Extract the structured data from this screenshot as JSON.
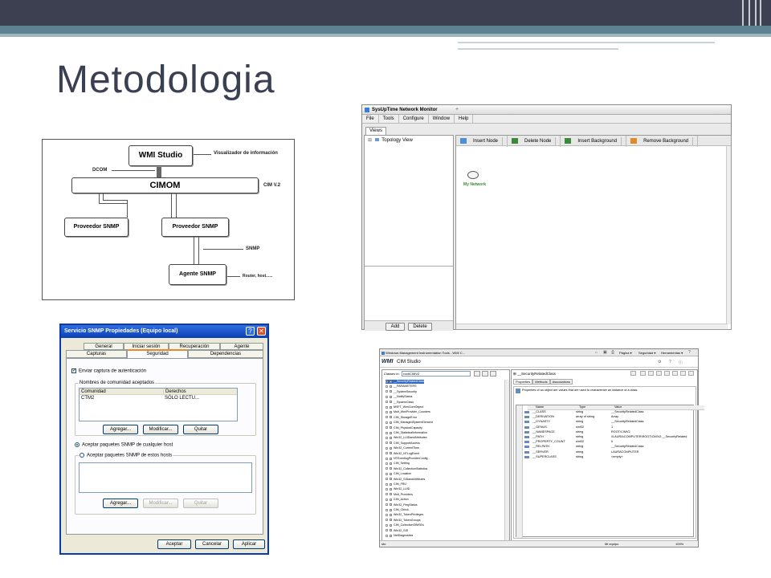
{
  "slide": {
    "title": "Metodologia"
  },
  "diagram": {
    "wmi_studio": "WMI Studio",
    "visualizador": "Visualizador de información",
    "dcom": "DCOM",
    "cimom": "CIMOM",
    "cim_v2": "CIM V.2",
    "proveedor_1": "Proveedor SNMP",
    "proveedor_2": "Proveedor SNMP",
    "snmp": "SNMP",
    "agente": "Agente SNMP",
    "router": "Router, host......"
  },
  "network_monitor": {
    "title": "SysUpTime Network Monitor",
    "menu": [
      "File",
      "Tools",
      "Configure",
      "Window",
      "Help"
    ],
    "tab": "Views",
    "tree_item": "Topology View",
    "toolbar": [
      "Insert Node",
      "Delete Node",
      "Insert Background",
      "Remove Background"
    ],
    "node_label": "My Network",
    "add_button": "Add",
    "delete_button": "Delete",
    "colors": {
      "insert_node": "#4a8fd8",
      "delete_node": "#3a8a3a",
      "insert_bg": "#3a8a3a",
      "remove_bg": "#e08a2a"
    }
  },
  "snmp_dialog": {
    "title": "Servicio SNMP Propiedades (Equipo local)",
    "help_btn": "?",
    "close_btn": "✕",
    "tabs_row1": [
      "General",
      "Iniciar sesión",
      "Recuperación",
      "Agente"
    ],
    "tabs_row2": [
      "Capturas",
      "Seguridad",
      "Dependencias"
    ],
    "check_label": "Enviar captura de autenticación",
    "group_label": "Nombres de comunidad aceptados",
    "col_comunidad": "Comunidad",
    "col_derechos": "Derechos",
    "row_comunidad": "CTM2",
    "row_derechos": "SÓLO LECTU...",
    "agregar": "Agregar...",
    "modificar": "Modificar...",
    "quitar": "Quitar",
    "radio1": "Aceptar paquetes SNMP de cualquier host",
    "radio2": "Aceptar paquetes SNMP de estos hosts",
    "agregar2": "Agregar...",
    "modificar2": "Modificar...",
    "quitar2": "Quitar",
    "aceptar": "Aceptar",
    "cancelar": "Cancelar",
    "aplicar": "Aplicar"
  },
  "wmi_window": {
    "title": "Windows Management Instrumentation Tools - WMI C...",
    "ie_menu": [
      "Página ▾",
      "Seguridad ▾",
      "Herramientas ▾"
    ],
    "logo": "WMI",
    "app_name": "CIM Studio",
    "classes_in": "Classes in:",
    "namespace": "root\\CIMV2",
    "class_header": "__SecurityRelatedClass",
    "tabs": [
      "Properties",
      "Methods",
      "Associations"
    ],
    "description": "Properties of an object are values that are used to characterize an instance of a class.",
    "tree": [
      "__SecurityRelatedClass",
      "__PARAMETERS",
      "__SystemSecurity",
      "__NotifyStatus",
      "__SystemClass",
      "MSFT_WmiCoreObject",
      "Msft_WmiProvider_Counters",
      "CIM_StorageError",
      "CIM_ManagedSystemElement",
      "CIM_PhysicalCapacity",
      "CIM_StatisticalInformation",
      "Win32_LUIDandAttributes",
      "CIM_SupportAccess",
      "Win32_CurrentTime",
      "Win32_NTLogEvent",
      "NTEventlogProviderConfig",
      "CIM_Setting",
      "Win32_CollectionStatistics",
      "CIM_Location",
      "Win32_SIDandAttributes",
      "CIM_FRU",
      "Win32_LUID",
      "Msft_Providers",
      "CIM_Action",
      "Win32_PingStatus",
      "CIM_Check",
      "Win32_TokenPrivileges",
      "Win32_TokenGroups",
      "CIM_CollectionOfMSEs",
      "Win32_SID",
      "NetDiagnostics"
    ],
    "prop_cols": [
      "Name",
      "Type",
      "Value"
    ],
    "properties": [
      {
        "name": "__CLASS",
        "type": "string",
        "value": "__SecurityRelatedClass"
      },
      {
        "name": "__DERIVATION",
        "type": "array of string",
        "value": "Array"
      },
      {
        "name": "__DYNASTY",
        "type": "string",
        "value": "__SecurityRelatedClass"
      },
      {
        "name": "__GENUS",
        "type": "sint32",
        "value": "1"
      },
      {
        "name": "__NAMESPACE",
        "type": "string",
        "value": "ROOT\\CIMV2"
      },
      {
        "name": "__PATH",
        "type": "string",
        "value": "\\\\LAURA\\COMPUTER\\ROOT\\CIMV2:__SecurityRelated"
      },
      {
        "name": "__PROPERTY_COUNT",
        "type": "sint32",
        "value": "0"
      },
      {
        "name": "__RELPATH",
        "type": "string",
        "value": "__SecurityRelatedClass"
      },
      {
        "name": "__SERVER",
        "type": "string",
        "value": "LAURACOMPUTER"
      },
      {
        "name": "__SUPERCLASS",
        "type": "string",
        "value": "<empty>"
      }
    ],
    "status_left": "sto",
    "status_zone": "Mi equipo",
    "status_zoom": "100%"
  }
}
